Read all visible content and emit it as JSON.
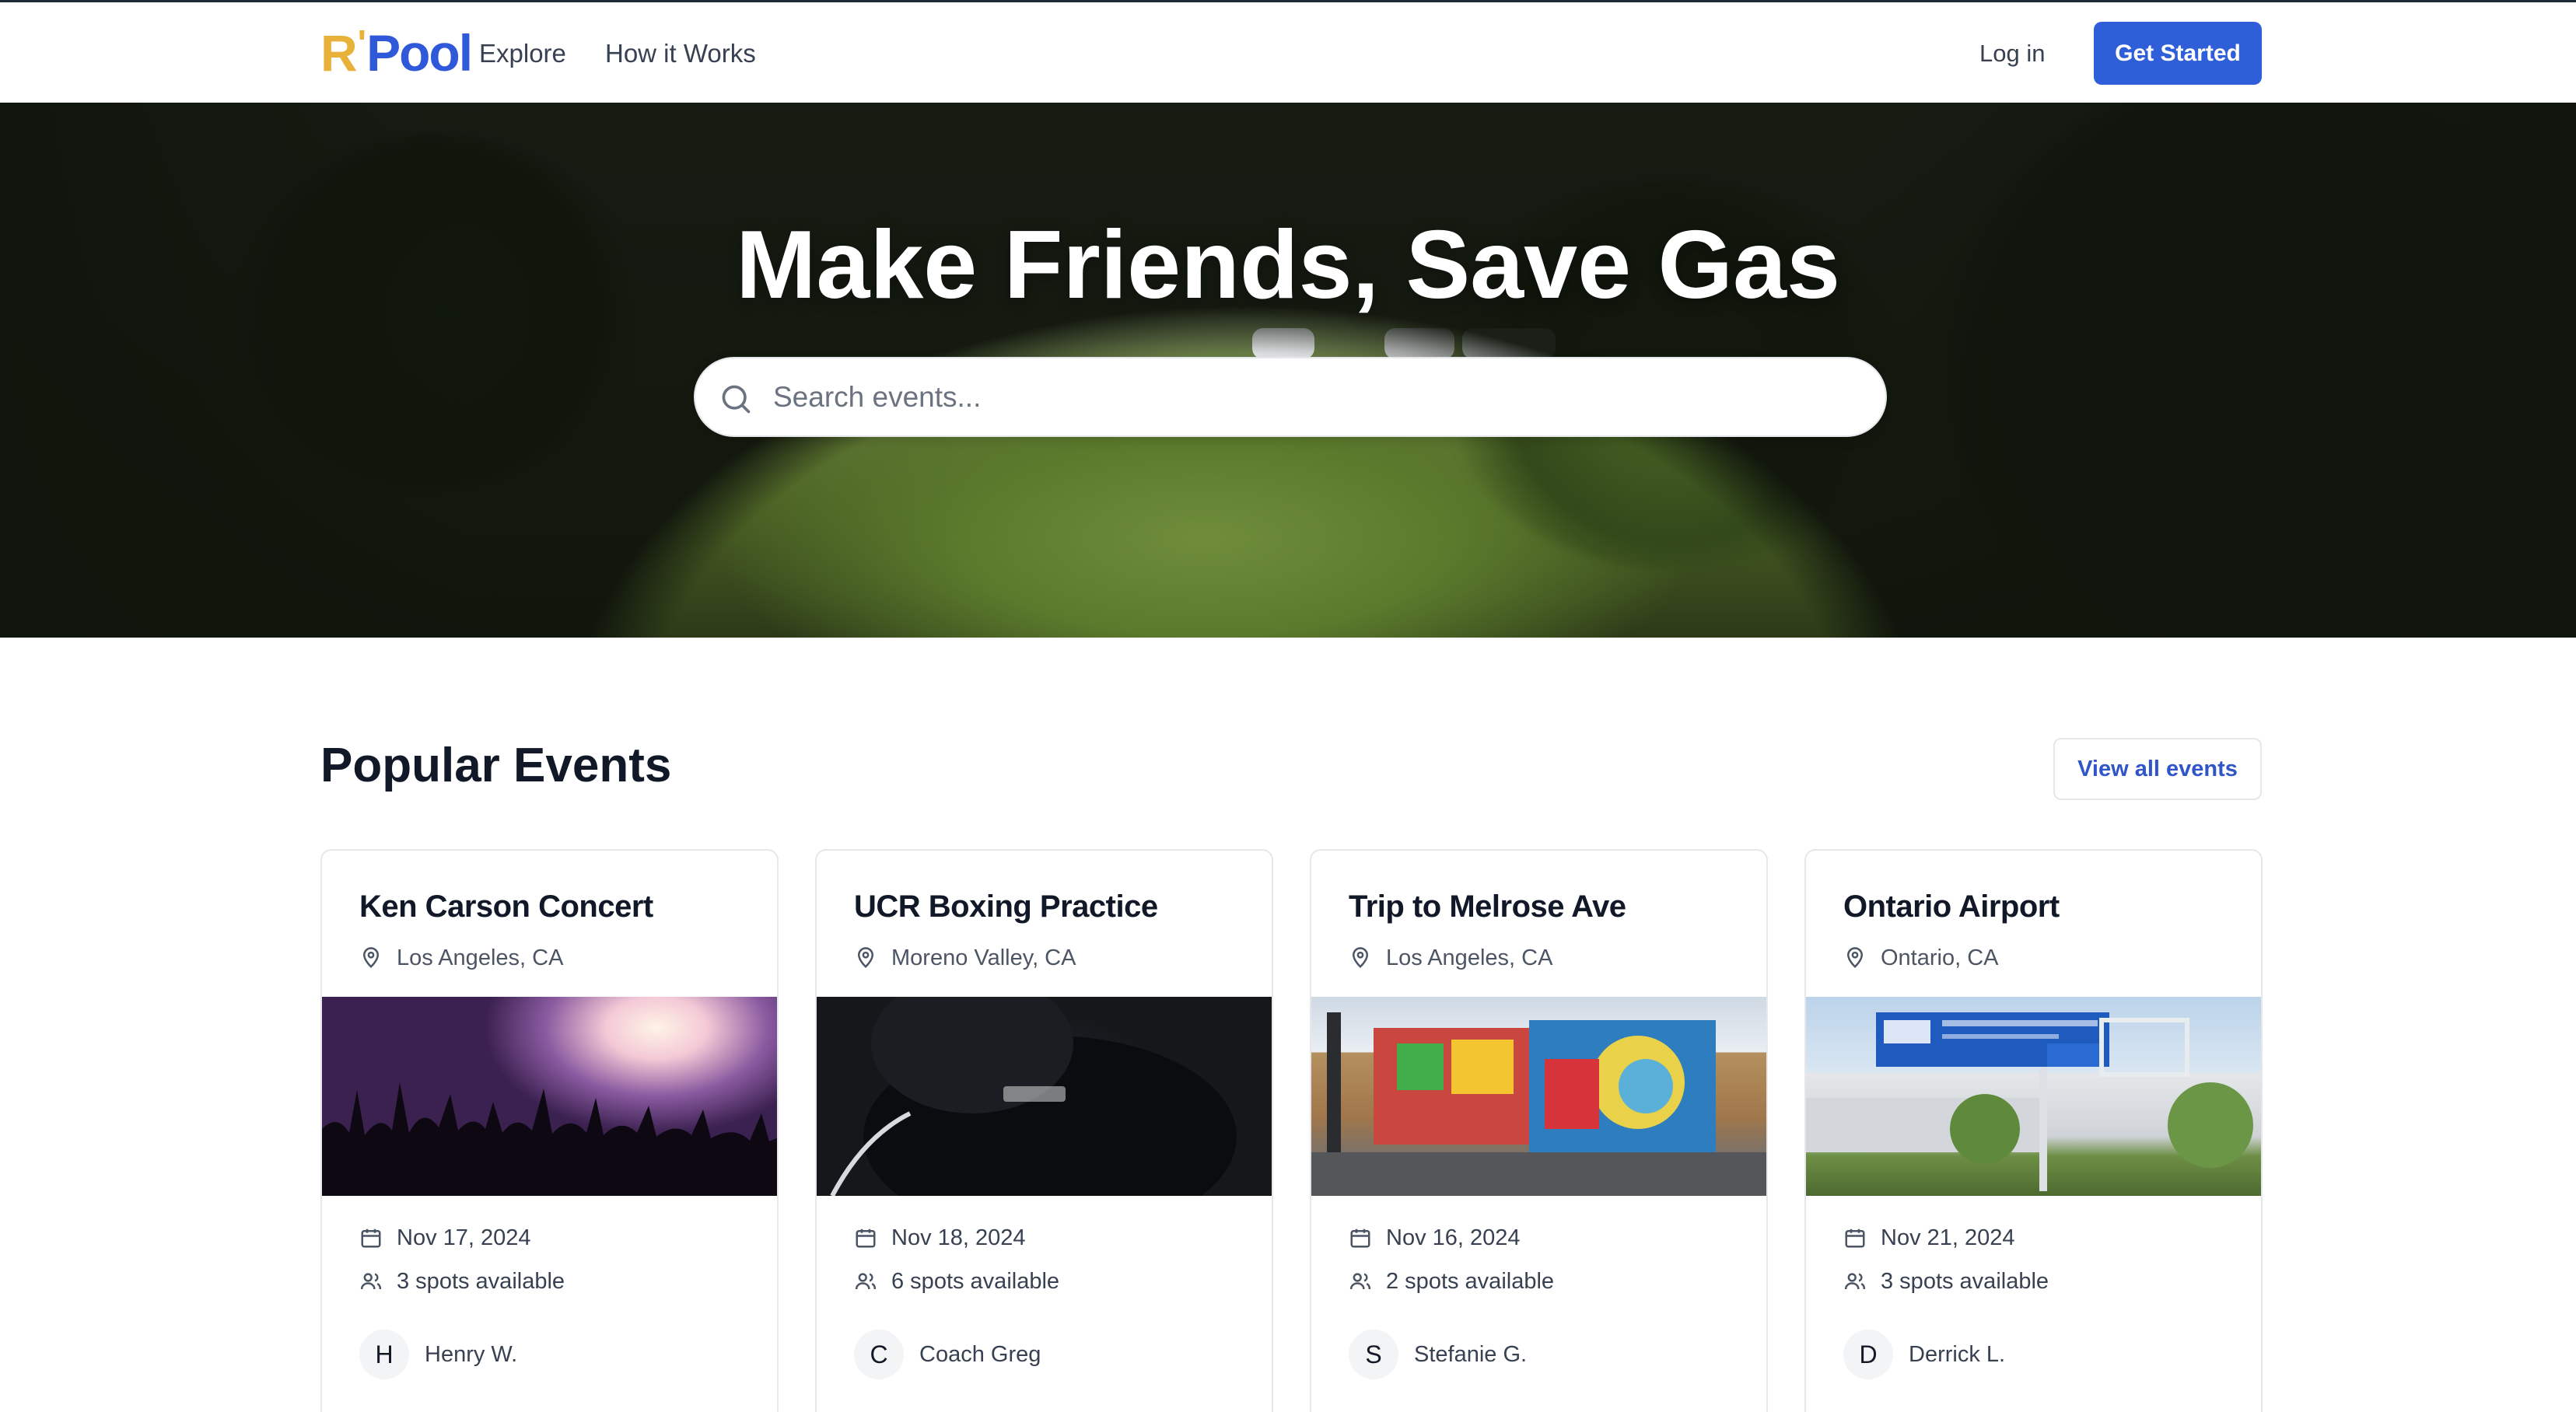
{
  "nav": {
    "logo": {
      "r": "R",
      "apos": "'",
      "pool": "Pool"
    },
    "links": [
      "Explore",
      "How it Works"
    ],
    "login": "Log in",
    "get_started": "Get Started"
  },
  "hero": {
    "title": "Make Friends, Save Gas",
    "search_placeholder": "Search events..."
  },
  "events_section": {
    "title": "Popular Events",
    "view_all": "View all events"
  },
  "events": [
    {
      "title": "Ken Carson Concert",
      "location": "Los Angeles, CA",
      "date": "Nov 17, 2024",
      "spots": "3 spots available",
      "host_initial": "H",
      "host": "Henry W."
    },
    {
      "title": "UCR Boxing Practice",
      "location": "Moreno Valley, CA",
      "date": "Nov 18, 2024",
      "spots": "6 spots available",
      "host_initial": "C",
      "host": "Coach Greg"
    },
    {
      "title": "Trip to Melrose Ave",
      "location": "Los Angeles, CA",
      "date": "Nov 16, 2024",
      "spots": "2 spots available",
      "host_initial": "S",
      "host": "Stefanie G."
    },
    {
      "title": "Ontario Airport",
      "location": "Ontario, CA",
      "date": "Nov 21, 2024",
      "spots": "3 spots available",
      "host_initial": "D",
      "host": "Derrick L."
    }
  ],
  "colors": {
    "primary": "#2f5fd8",
    "logo_r": "#e8b23a",
    "logo_pool": "#2f59d9"
  }
}
